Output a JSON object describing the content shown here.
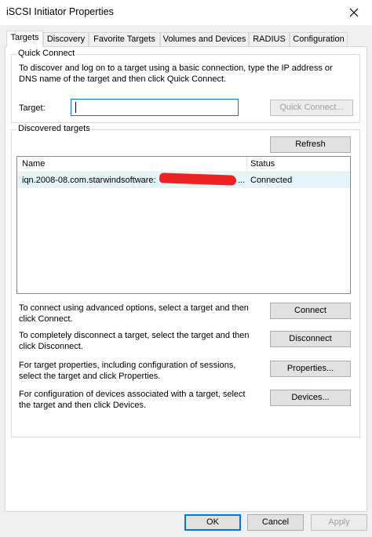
{
  "window": {
    "title": "iSCSI Initiator Properties"
  },
  "tabs": [
    {
      "label": "Targets",
      "active": true
    },
    {
      "label": "Discovery"
    },
    {
      "label": "Favorite Targets"
    },
    {
      "label": "Volumes and Devices"
    },
    {
      "label": "RADIUS"
    },
    {
      "label": "Configuration"
    }
  ],
  "quick_connect": {
    "title": "Quick Connect",
    "description": "To discover and log on to a target using a basic connection, type the IP address or DNS name of the target and then click Quick Connect.",
    "target_label": "Target:",
    "target_value": "",
    "button": "Quick Connect..."
  },
  "discovered": {
    "title": "Discovered targets",
    "refresh": "Refresh",
    "columns": [
      "Name",
      "Status"
    ],
    "rows": [
      {
        "name": "iqn.2008-08.com.starwindsoftware:",
        "ellipsis": "...",
        "status": "Connected"
      }
    ]
  },
  "actions": [
    {
      "text": "To connect using advanced options, select a target and then click Connect.",
      "button": "Connect"
    },
    {
      "text": "To completely disconnect a target, select the target and then click Disconnect.",
      "button": "Disconnect"
    },
    {
      "text": "For target properties, including configuration of sessions, select the target and click Properties.",
      "button": "Properties..."
    },
    {
      "text": "For configuration of devices associated with a target, select the target and then click Devices.",
      "button": "Devices..."
    }
  ],
  "footer": {
    "ok": "OK",
    "cancel": "Cancel",
    "apply": "Apply"
  },
  "icons": {
    "close": "close-icon"
  },
  "colors": {
    "focus": "#0078d7",
    "selected_row": "#e5f3fb",
    "redaction": "#ee2222"
  }
}
